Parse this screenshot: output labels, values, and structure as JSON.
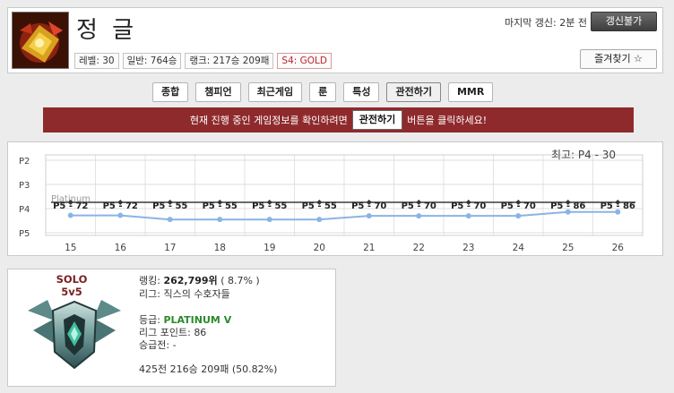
{
  "header": {
    "name": "정 글",
    "last_update": "마지막 갱신: 2분 전",
    "update_button": "갱신불가",
    "favorite_button": "즐겨찾기 ☆",
    "badges": [
      "레벨: 30",
      "일반: 764승",
      "랭크: 217승 209패",
      "S4: GOLD"
    ]
  },
  "tabs": [
    "종합",
    "챔피언",
    "최근게임",
    "룬",
    "특성",
    "관전하기",
    "MMR"
  ],
  "active_tab": "관전하기",
  "banner": {
    "before": "현재 진행 중인 게임정보를 확인하려면",
    "button": "관전하기",
    "after": "버튼을 클릭하세요!"
  },
  "chart_data": {
    "type": "line",
    "best_label": "최고: P4 - 30",
    "y_ticks": [
      "P2",
      "P3",
      "P4",
      "P5"
    ],
    "band_label": "Platinum",
    "x": [
      "15",
      "16",
      "17",
      "18",
      "19",
      "20",
      "21",
      "22",
      "23",
      "24",
      "25",
      "26"
    ],
    "series": [
      {
        "values": [
          72,
          72,
          55,
          55,
          55,
          55,
          70,
          70,
          70,
          70,
          86,
          86
        ],
        "point_labels": [
          "P5 - 72",
          "P5 - 72",
          "P5 - 55",
          "P5 - 55",
          "P5 - 55",
          "P5 - 55",
          "P5 - 70",
          "P5 - 70",
          "P5 - 70",
          "P5 - 70",
          "P5 - 86",
          "P5 - 86"
        ]
      }
    ],
    "colors": {
      "line": "#8ab4e4",
      "band": "#3b3b3b"
    }
  },
  "rank": {
    "queue": "SOLO\n5v5",
    "queue_line1": "SOLO",
    "queue_line2": "5v5",
    "ranking_label": "랭킹:",
    "ranking_value": "262,799위",
    "ranking_pct": "( 8.7% )",
    "league_label": "리그:",
    "league_name": "직스의 수호자들",
    "tier_label": "등급:",
    "tier_value": "PLATINUM V",
    "lp_label": "리그 포인트:",
    "lp_value": "86",
    "promo_label": "승급전:",
    "promo_value": "-",
    "record": "425전 216승 209패 (50.82%)"
  }
}
